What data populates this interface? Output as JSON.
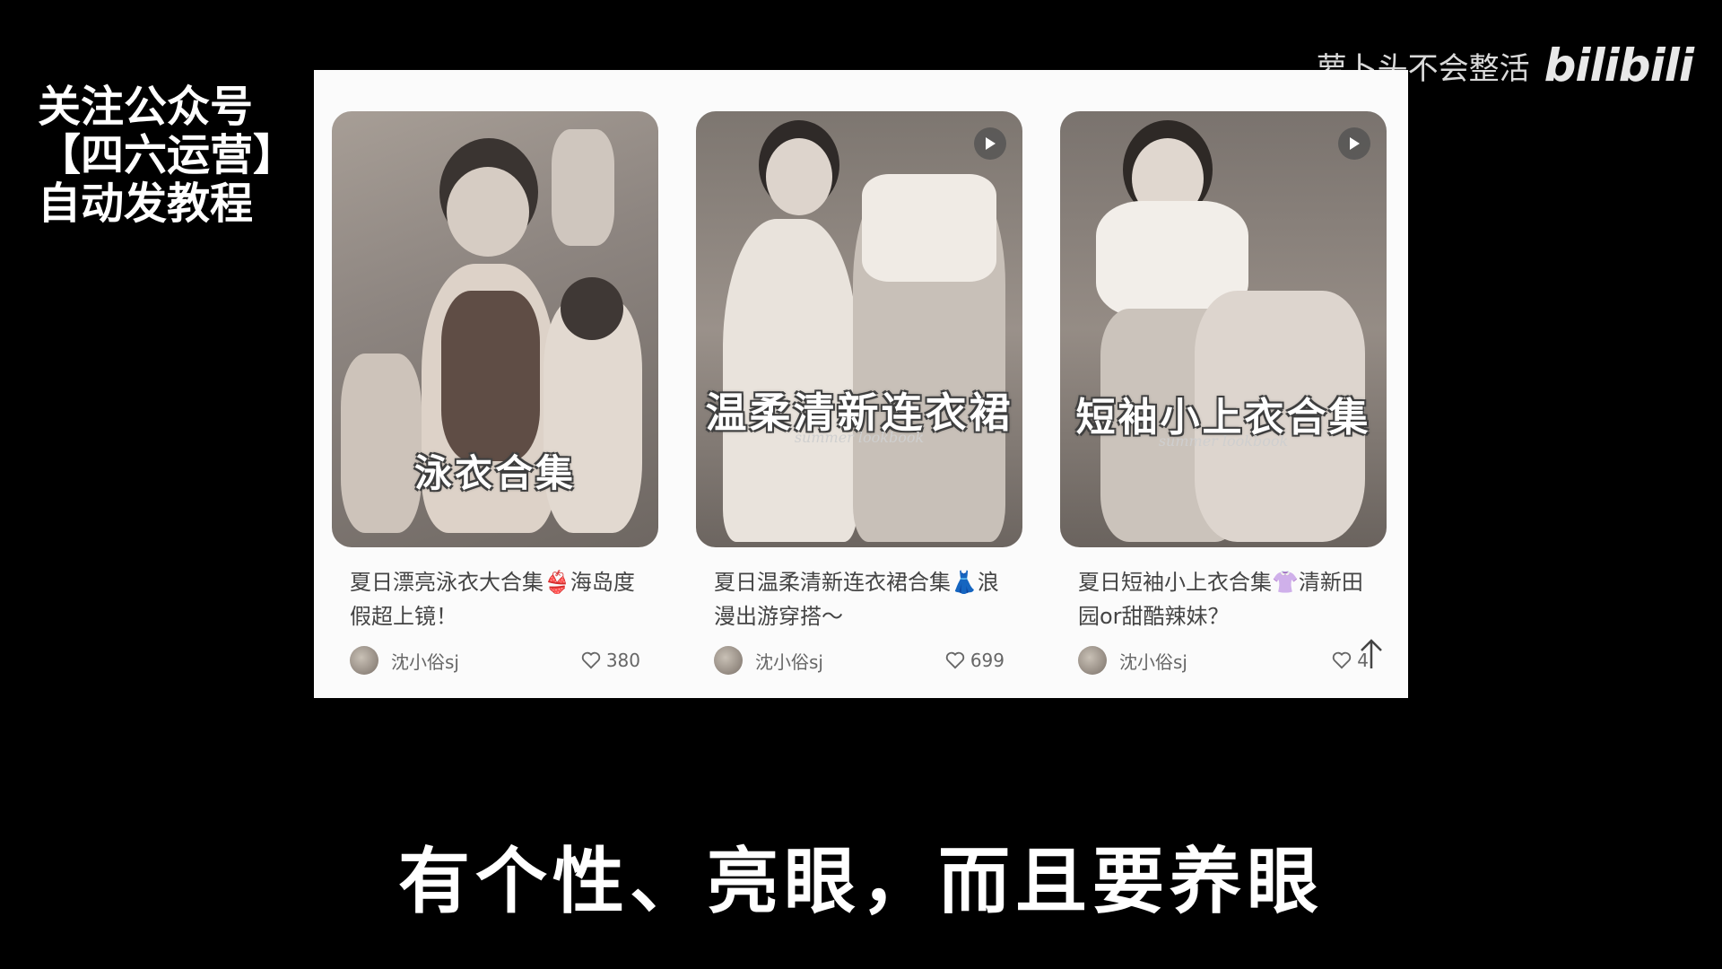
{
  "promo": {
    "line1": "关注公众号",
    "line2": "【四六运营】",
    "line3": "自动发教程"
  },
  "watermark": {
    "channel": "萝卜头不会整活",
    "logo": "bilibili"
  },
  "cards": [
    {
      "cover_title": "泳衣合集",
      "cover_sub": "",
      "caption": "夏日漂亮泳衣大合集👙海岛度假超上镜！",
      "author": "沈小俗sj",
      "likes": "380",
      "has_play": false
    },
    {
      "cover_title": "温柔清新连衣裙",
      "cover_sub": "summer lookbook",
      "caption": "夏日温柔清新连衣裙合集👗浪漫出游穿搭～",
      "author": "沈小俗sj",
      "likes": "699",
      "has_play": true
    },
    {
      "cover_title": "短袖小上衣合集",
      "cover_sub": "summer lookbook",
      "caption": "夏日短袖小上衣合集👚清新田园or甜酷辣妹？",
      "author": "沈小俗sj",
      "likes": "4",
      "has_play": true
    }
  ],
  "icons": {
    "heart": "heart-icon",
    "play": "play-icon",
    "scroll_top": "arrow-up-icon"
  },
  "subtitle": "有个性、亮眼，而且要养眼"
}
